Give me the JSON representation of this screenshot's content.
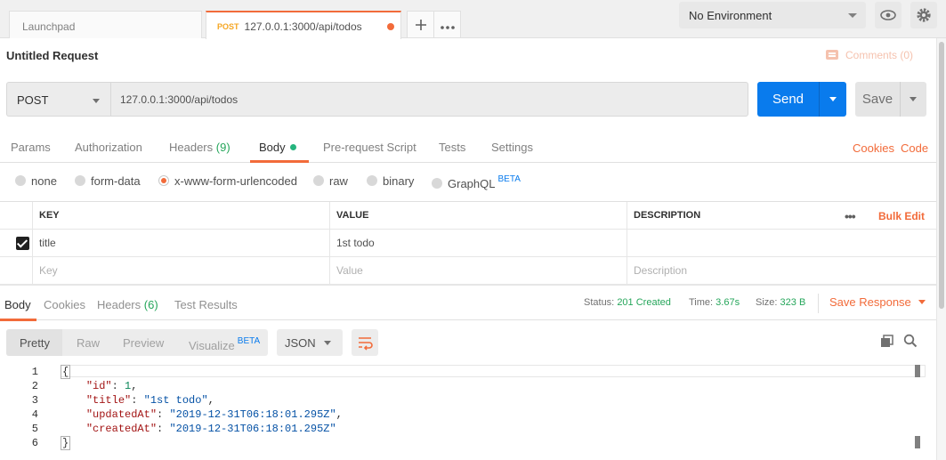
{
  "tabs": {
    "launchpad": "Launchpad",
    "active_method": "POST",
    "active_url": "127.0.0.1:3000/api/todos",
    "add_icon": "plus-icon",
    "more_icon": "more-horizontal-icon"
  },
  "environment": {
    "selected": "No Environment"
  },
  "request": {
    "title": "Untitled Request",
    "comments": "Comments (0)",
    "method": "POST",
    "url": "127.0.0.1:3000/api/todos",
    "send": "Send",
    "save": "Save"
  },
  "request_tabs": {
    "params": "Params",
    "authorization": "Authorization",
    "headers": "Headers",
    "headers_count": "(9)",
    "body": "Body",
    "pre_request": "Pre-request Script",
    "tests": "Tests",
    "settings": "Settings",
    "cookies": "Cookies",
    "code": "Code"
  },
  "body_types": {
    "none": "none",
    "form_data": "form-data",
    "urlencoded": "x-www-form-urlencoded",
    "raw": "raw",
    "binary": "binary",
    "graphql": "GraphQL",
    "beta": "BETA",
    "selected": "x-www-form-urlencoded"
  },
  "params_table": {
    "headers": {
      "key": "KEY",
      "value": "VALUE",
      "description": "DESCRIPTION",
      "bulk_edit": "Bulk Edit"
    },
    "rows": [
      {
        "key": "title",
        "value": "1st todo",
        "description": "",
        "checked": true
      }
    ],
    "placeholders": {
      "key": "Key",
      "value": "Value",
      "description": "Description"
    }
  },
  "response": {
    "tabs": {
      "body": "Body",
      "cookies": "Cookies",
      "headers": "Headers",
      "headers_count": "(6)",
      "test_results": "Test Results"
    },
    "status_label": "Status:",
    "status_value": "201 Created",
    "time_label": "Time:",
    "time_value": "3.67s",
    "size_label": "Size:",
    "size_value": "323 B",
    "save_response": "Save Response",
    "views": {
      "pretty": "Pretty",
      "raw": "Raw",
      "preview": "Preview",
      "visualize": "Visualize",
      "beta": "BETA"
    },
    "format": "JSON",
    "line_numbers": [
      "1",
      "2",
      "3",
      "4",
      "5",
      "6"
    ],
    "json": {
      "open": "{",
      "id_key": "\"id\"",
      "id_val": "1",
      "title_key": "\"title\"",
      "title_val": "\"1st todo\"",
      "updated_key": "\"updatedAt\"",
      "updated_val": "\"2019-12-31T06:18:01.295Z\"",
      "created_key": "\"createdAt\"",
      "created_val": "\"2019-12-31T06:18:01.295Z\"",
      "close": "}"
    }
  },
  "colors": {
    "accent": "#f26b3a",
    "send_blue": "#097bed",
    "success_green": "#26a65b"
  }
}
